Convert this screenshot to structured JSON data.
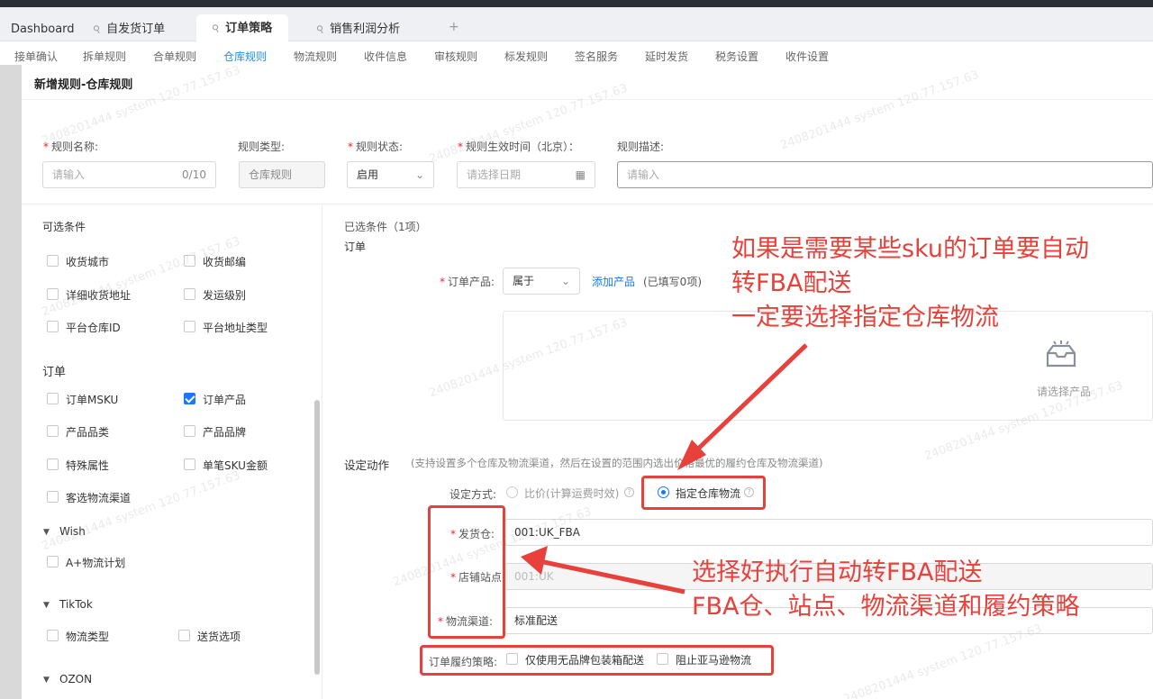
{
  "tabs": [
    {
      "label": "Dashboard"
    },
    {
      "label": "自发货订单"
    },
    {
      "label": "订单策略"
    },
    {
      "label": "销售利润分析"
    }
  ],
  "subnav": [
    "接单确认",
    "拆单规则",
    "合单规则",
    "仓库规则",
    "物流规则",
    "收件信息",
    "审核规则",
    "标发规则",
    "签名服务",
    "延时发货",
    "税务设置",
    "收件设置"
  ],
  "modal": {
    "title": "新增规则-仓库规则",
    "form": {
      "name_label": "规则名称:",
      "name_placeholder": "请输入",
      "name_count": "0/10",
      "type_label": "规则类型:",
      "type_value": "仓库规则",
      "status_label": "规则状态:",
      "status_value": "启用",
      "time_label": "规则生效时间（北京）：",
      "time_placeholder": "请选择日期",
      "desc_label": "规则描述:",
      "desc_placeholder": "请输入"
    },
    "left": {
      "title": "可选条件",
      "group1": [
        "收货城市",
        "收货邮编",
        "详细收货地址",
        "发运级别",
        "平台仓库ID",
        "平台地址类型"
      ],
      "order_title": "订单",
      "order_items": [
        "订单MSKU",
        "订单产品",
        "产品品类",
        "产品品牌",
        "特殊属性",
        "单笔SKU金额",
        "客选物流渠道"
      ],
      "wish_title": "Wish",
      "wish_items": [
        "A+物流计划"
      ],
      "tiktok_title": "TikTok",
      "tiktok_items": [
        "物流类型",
        "送货选项"
      ],
      "ozon_title": "OZON"
    },
    "right": {
      "selected_title": "已选条件（1项）",
      "order_label": "订单",
      "product_label": "订单产品:",
      "product_op": "属于",
      "add_product": "添加产品",
      "filled": "(已填写0项)",
      "empty_text": "请选择产品",
      "action_title": "设定动作",
      "action_desc": "(支持设置多个仓库及物流渠道，然后在设置的范围内选出价格最优的履约仓库及物流渠道)",
      "mode_label": "设定方式:",
      "mode_opt1": "比价(计算运费时效)",
      "mode_opt2": "指定仓库物流",
      "warehouse_label": "发货仓:",
      "warehouse_value": "001:UK_FBA",
      "site_label": "店铺站点:",
      "site_value": "001:UK",
      "channel_label": "物流渠道:",
      "channel_value": "标准配送",
      "policy_label": "订单履约策略:",
      "policy_opt1": "仅使用无品牌包装箱配送",
      "policy_opt2": "阻止亚马逊物流"
    }
  },
  "annotations": {
    "top": [
      "如果是需要某些sku的订单要自动",
      "转FBA配送",
      "一定要选择指定仓库物流"
    ],
    "bottom": [
      "选择好执行自动转FBA配送",
      "FBA仓、站点、物流渠道和履约策略"
    ]
  },
  "watermark": "2408201444 system 120.77.157.63",
  "colors": {
    "accent": "#1677ff",
    "annotation": "#e8403a",
    "required": "#f5222d"
  }
}
